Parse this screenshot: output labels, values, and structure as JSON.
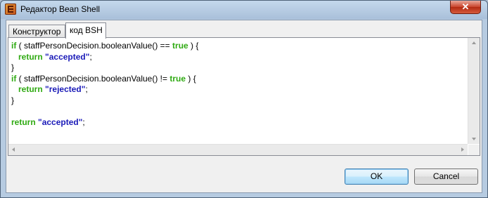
{
  "window": {
    "title": "Редактор Bean Shell",
    "close_glyph": "✕"
  },
  "tabs": [
    {
      "label": "Конструктор",
      "active": false
    },
    {
      "label": "код BSH",
      "active": true
    }
  ],
  "code": [
    [
      "if",
      " ( staffPersonDecision.booleanValue() == ",
      "true",
      " ) {"
    ],
    [
      "   ",
      "return",
      " ",
      "\"accepted\"",
      ";"
    ],
    [
      "}"
    ],
    [
      "if",
      " ( staffPersonDecision.booleanValue() != ",
      "true",
      " ) {"
    ],
    [
      "   ",
      "return",
      " ",
      "\"rejected\"",
      ";"
    ],
    [
      "}"
    ],
    [
      ""
    ],
    [
      "return",
      " ",
      "\"accepted\"",
      ";"
    ]
  ],
  "buttons": {
    "ok": "OK",
    "cancel": "Cancel"
  },
  "colors": {
    "keyword": "#2faa12",
    "string": "#1a1ab8"
  }
}
